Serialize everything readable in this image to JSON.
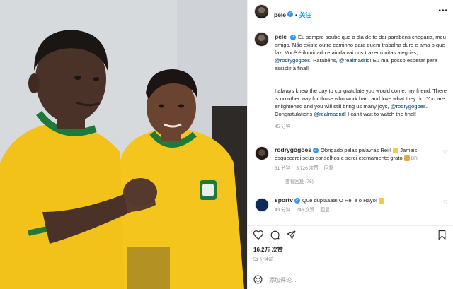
{
  "post": {
    "username": "pele",
    "follow_label": "关注",
    "more_label": "•••"
  },
  "caption": {
    "username": "pele",
    "pt_prefix": "Eu sempre soube que o dia de te dar parabéns chegaria, meu amigo. Não existe outro caminho para quem trabalha duro e ama o que faz. Você é iluminado e ainda vai nos trazer muitas alegrias, ",
    "pt_mention1": "@rodrygogoes",
    "pt_mid": ". Parabéns, ",
    "pt_mention2": "@realmadrid",
    "pt_suffix": "! Eu mal posso esperar para assistir a final!",
    "dot": ".",
    "en_prefix": "I always knew the day to congratulate you would come, my friend. There is no other way for those who work hard and love what they do. You are enlightened and you will still bring us many joys, ",
    "en_mention1": "@rodrygogoes",
    "en_mid": ". Congratulations ",
    "en_mention2": "@realmadrid",
    "en_suffix": "! I can't wait to watch the final!",
    "time": "45 分钟"
  },
  "comments": [
    {
      "username": "rodrygogoes",
      "text": "Obrigado pelas palavras Rei!! ",
      "text2": " Jamais esquecerei seus conselhos e serei eternamente grato ",
      "badge": "BR",
      "time": "31 分钟",
      "likes": "3,726 次赞",
      "reply": "回复",
      "view_replies": "—— 查看回复 (75)"
    },
    {
      "username": "sportv",
      "text": "Que duplaaaa! O Rei e o Rayo! ",
      "time": "43 分钟",
      "likes": "246 次赞",
      "reply": "回复"
    }
  ],
  "stats": {
    "likes": "16.2万 次赞",
    "time_ago": "51 分钟前"
  },
  "add_comment": {
    "placeholder": "添加评论..."
  },
  "colors": {
    "link": "#00376b",
    "verified": "#3797f0",
    "follow": "#0095f6",
    "jersey_yellow": "#f2c21b",
    "jersey_green": "#1f7a3a"
  },
  "icons": [
    "heart-icon",
    "comment-icon",
    "share-icon",
    "bookmark-icon",
    "smile-icon",
    "more-icon",
    "verified-icon"
  ]
}
